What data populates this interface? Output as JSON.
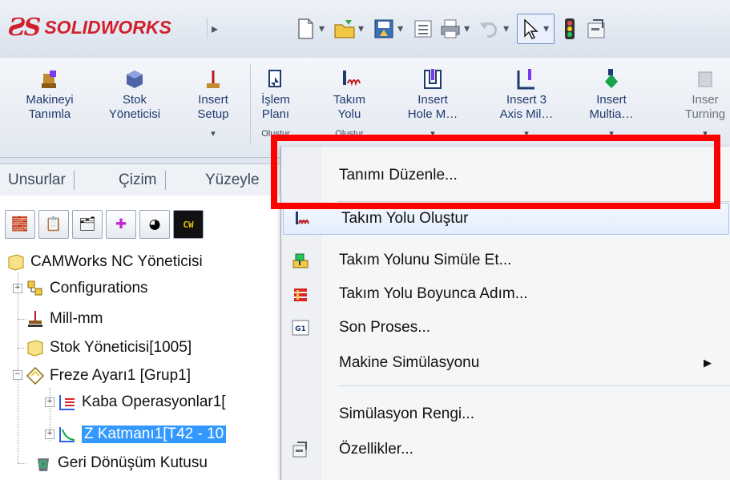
{
  "brand": {
    "mark": "ƧS",
    "name_a": "SOLID",
    "name_b": "WORKS"
  },
  "ribbon": {
    "buttons": [
      {
        "line1": "Makineyi",
        "line2": "Tanımla",
        "dropdown": ""
      },
      {
        "line1": "Stok",
        "line2": "Yöneticisi",
        "dropdown": ""
      },
      {
        "line1": "Insert",
        "line2": "Setup",
        "dropdown": "▾"
      },
      {
        "line1": "İşlem",
        "line2": "Planı",
        "dropdown": "Oluştur"
      },
      {
        "line1": "Takım",
        "line2": "Yolu",
        "dropdown": "Oluştur"
      },
      {
        "line1": "Insert",
        "line2": "Hole M…",
        "dropdown": "▾"
      },
      {
        "line1": "Insert 3",
        "line2": "Axis Mil…",
        "dropdown": "▾"
      },
      {
        "line1": "Insert",
        "line2": "Multia…",
        "dropdown": "▾"
      },
      {
        "line1": "Inser",
        "line2": "Turning",
        "dropdown": "▾"
      }
    ]
  },
  "tabs": [
    "Unsurlar",
    "Çizim",
    "Yüzeyle"
  ],
  "tree": {
    "root": "CAMWorks NC Yöneticisi",
    "items": [
      "Configurations",
      "Mill-mm",
      "Stok Yöneticisi[1005]",
      "Freze Ayarı1 [Grup1]",
      "Kaba Operasyonlar1[",
      "Z Katmanı1[T42 - 10",
      "Geri Dönüşüm Kutusu"
    ]
  },
  "pane_icons": {
    "cw": "CW"
  },
  "menu": {
    "items": [
      {
        "label": "Tanımı Düzenle...",
        "icon": ""
      },
      {
        "label": "Takım Yolu Oluştur",
        "icon": "toolpath-icon"
      },
      {
        "label": "Takım Yolunu Simüle Et...",
        "icon": "simulate-icon"
      },
      {
        "label": "Takım Yolu Boyunca Adım...",
        "icon": "step-icon"
      },
      {
        "label": "Son Proses...",
        "icon": "g1-icon",
        "icon_text": "G1"
      },
      {
        "label": "Makine Simülasyonu",
        "icon": "",
        "submenu": "▶"
      },
      {
        "label": "Simülasyon Rengi...",
        "icon": ""
      },
      {
        "label": "Özellikler...",
        "icon": "properties-icon"
      }
    ]
  },
  "colors": {
    "highlight": "#ff0000",
    "brand": "#d21f2b",
    "selection": "#3399ff"
  }
}
